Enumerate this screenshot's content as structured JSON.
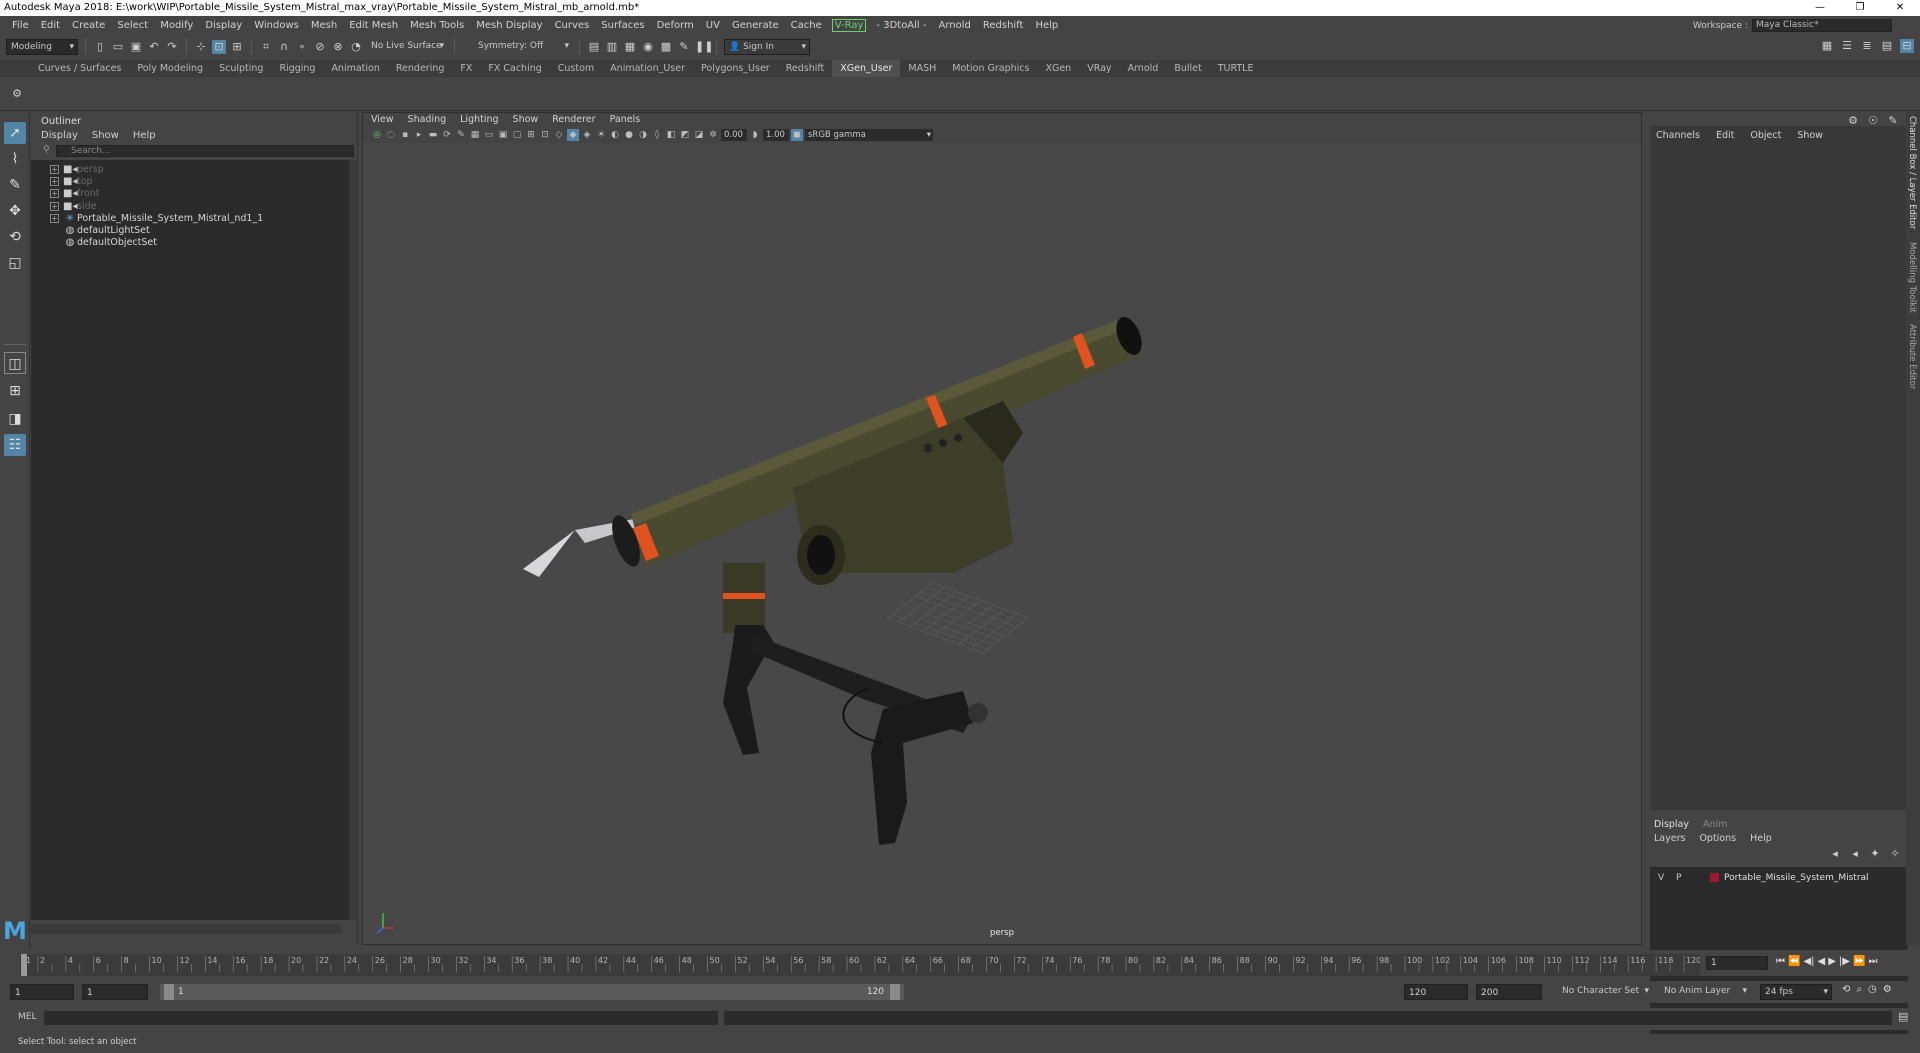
{
  "title_bar": {
    "title": "Autodesk Maya 2018: E:\\work\\WIP\\Portable_Missile_System_Mistral_max_vray\\Portable_Missile_System_Mistral_mb_arnold.mb*",
    "minimize": "—",
    "restore": "❐",
    "close": "✕"
  },
  "menu": {
    "items": [
      "File",
      "Edit",
      "Create",
      "Select",
      "Modify",
      "Display",
      "Windows",
      "Mesh",
      "Edit Mesh",
      "Mesh Tools",
      "Mesh Display",
      "Curves",
      "Surfaces",
      "Deform",
      "UV",
      "Generate",
      "Cache"
    ],
    "vray": "V-Ray",
    "items2": [
      "- 3DtoAll -",
      "Arnold",
      "Redshift",
      "Help"
    ]
  },
  "workspace": {
    "label": "Workspace :",
    "value": "Maya Classic*"
  },
  "status_line": {
    "mode": "Modeling",
    "live_surface": "No Live Surface",
    "symmetry": "Symmetry: Off",
    "sign_in": "Sign In"
  },
  "shelf_tabs": [
    "Curves / Surfaces",
    "Poly Modeling",
    "Sculpting",
    "Rigging",
    "Animation",
    "Rendering",
    "FX",
    "FX Caching",
    "Custom",
    "Animation_User",
    "Polygons_User",
    "Redshift",
    "XGen_User",
    "MASH",
    "Motion Graphics",
    "XGen",
    "VRay",
    "Arnold",
    "Bullet",
    "TURTLE"
  ],
  "active_shelf_tab": "XGen_User",
  "outliner": {
    "title": "Outliner",
    "menu": [
      "Display",
      "Show",
      "Help"
    ],
    "search_placeholder": "Search...",
    "rows": [
      {
        "label": "persp",
        "icon": "camera-icon",
        "dim": true
      },
      {
        "label": "top",
        "icon": "camera-icon",
        "dim": true
      },
      {
        "label": "front",
        "icon": "camera-icon",
        "dim": true
      },
      {
        "label": "side",
        "icon": "camera-icon",
        "dim": true
      },
      {
        "label": "Portable_Missile_System_Mistral_nd1_1",
        "icon": "group-icon",
        "dim": false
      },
      {
        "label": "defaultLightSet",
        "icon": "set-icon",
        "dim": false
      },
      {
        "label": "defaultObjectSet",
        "icon": "set-icon",
        "dim": false
      }
    ]
  },
  "viewport": {
    "menu": [
      "View",
      "Shading",
      "Lighting",
      "Show",
      "Renderer",
      "Panels"
    ],
    "exposure": "0.00",
    "gamma": "1.00",
    "color_space": "sRGB gamma",
    "camera_label": "persp"
  },
  "channel_box": {
    "menu": [
      "Channels",
      "Edit",
      "Object",
      "Show"
    ]
  },
  "layer_editor": {
    "tabs": [
      "Display",
      "Anim"
    ],
    "menu": [
      "Layers",
      "Options",
      "Help"
    ],
    "layer": {
      "v": "V",
      "p": "P",
      "name": "Portable_Missile_System_Mistral",
      "color": "#a3182c"
    }
  },
  "side_tabs": [
    "Channel Box / Layer Editor",
    "Modelling Toolkit",
    "Attribute Editor"
  ],
  "time_slider": {
    "ticks": [
      "1",
      "2",
      "4",
      "6",
      "8",
      "10",
      "12",
      "14",
      "16",
      "18",
      "20",
      "22",
      "24",
      "26",
      "28",
      "30",
      "32",
      "34",
      "36",
      "38",
      "40",
      "42",
      "44",
      "46",
      "48",
      "50",
      "52",
      "54",
      "56",
      "58",
      "60",
      "62",
      "64",
      "66",
      "68",
      "70",
      "72",
      "74",
      "76",
      "78",
      "80",
      "82",
      "84",
      "86",
      "88",
      "90",
      "92",
      "94",
      "96",
      "98",
      "100",
      "102",
      "104",
      "106",
      "108",
      "110",
      "112",
      "114",
      "116",
      "118",
      "120"
    ],
    "current_frame": "1"
  },
  "range_slider": {
    "start": "1",
    "inner_start": "1",
    "range_start_label": "1",
    "range_end_label": "120",
    "end": "120",
    "anim_end": "200",
    "character_set": "No Character Set",
    "anim_layer": "No Anim Layer",
    "fps": "24 fps"
  },
  "command_line": {
    "label": "MEL"
  },
  "help_line": {
    "text": "Select Tool: select an object"
  },
  "colors": {
    "accent": "#5285a6",
    "vray_green": "#6cd36c"
  }
}
